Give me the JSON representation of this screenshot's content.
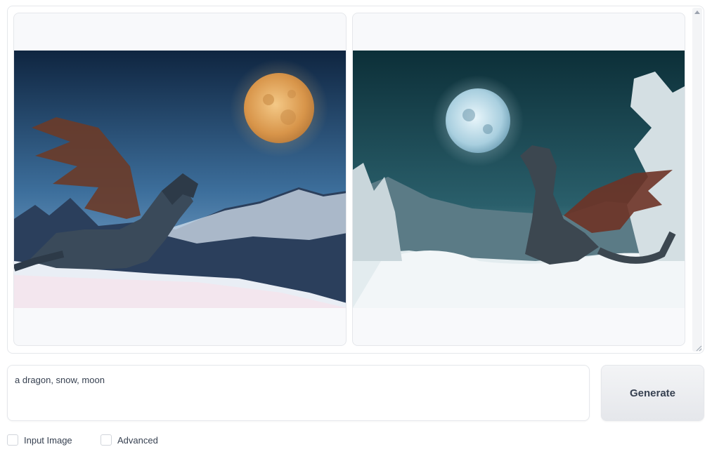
{
  "gallery": {
    "images": [
      {
        "alt": "dragon on snowy peak with golden full moon",
        "moon_color": "#e8a857",
        "sky_color": "#1e3a5f"
      },
      {
        "alt": "dragon in snowy forest with blue full moon",
        "moon_color": "#cfe6f2",
        "sky_color": "#0f3a44"
      }
    ]
  },
  "prompt": {
    "value": "a dragon, snow, moon"
  },
  "generate": {
    "label": "Generate"
  },
  "options": [
    {
      "label": "Input Image",
      "checked": false
    },
    {
      "label": "Advanced",
      "checked": false
    }
  ],
  "colors": {
    "border": "#e5e7eb",
    "tile_bg": "#f8f9fb",
    "button_bg": "#e5e7eb"
  }
}
